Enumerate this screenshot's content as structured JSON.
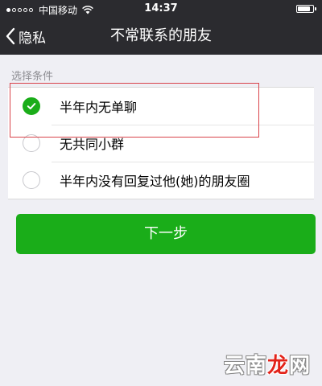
{
  "status_bar": {
    "carrier": "中国移动",
    "time": "14:37",
    "signal_dots_filled": 1,
    "signal_dots_total": 5,
    "battery_level": 0.85,
    "icons": [
      "wifi-icon",
      "battery-icon"
    ]
  },
  "nav": {
    "back_label": "隐私",
    "title": "不常联系的朋友",
    "back_icon": "chevron-left-icon"
  },
  "filter": {
    "section_label": "选择条件",
    "options": [
      {
        "label": "半年内无单聊",
        "checked": true
      },
      {
        "label": "无共同小群",
        "checked": false
      },
      {
        "label": "半年内没有回复过他(她)的朋友圈",
        "checked": false
      }
    ]
  },
  "actions": {
    "next_label": "下一步"
  },
  "watermark": {
    "part1": "云南",
    "part2": "龙",
    "part3": "网"
  },
  "colors": {
    "nav_bg": "#2b2b2f",
    "accent_green": "#1aad19",
    "page_bg": "#efeff4",
    "highlight_red": "#d9434a"
  }
}
